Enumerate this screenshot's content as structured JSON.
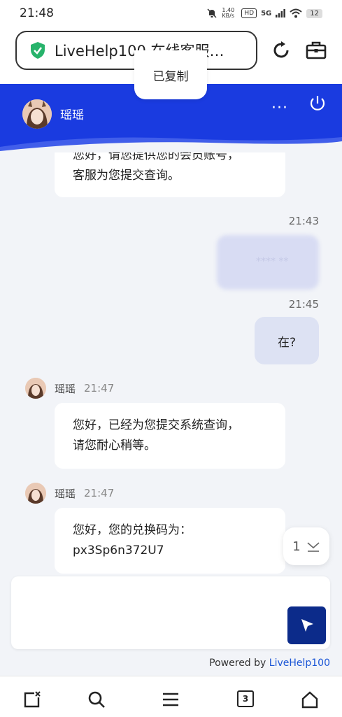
{
  "status_bar": {
    "time": "21:48",
    "net_speed": "1.40 KB/s",
    "hd": "HD",
    "signal": "5G",
    "battery": "12"
  },
  "browser": {
    "url_title": "LiveHelp100 在线客服…",
    "toast": "已复制"
  },
  "header": {
    "agent_name": "瑶瑶",
    "more": "···"
  },
  "messages": {
    "m1_line1": "您好，请您提供您的会员账号，",
    "m1_line2": "客服为您提交查询。",
    "time_1": "21:43",
    "blurred_text": "**** **",
    "time_2": "21:45",
    "user_msg_2": "在?",
    "agent_1_name": "瑶瑶",
    "agent_1_time": "21:47",
    "m3_line1": "您好，已经为您提交系统查询，",
    "m3_line2": "请您耐心稍等。",
    "agent_2_name": "瑶瑶",
    "agent_2_time": "21:47",
    "m4_line1": "您好，您的兑换码为：",
    "m4_line2": "px3Sp6n372U7"
  },
  "scroll_badge": {
    "count": "1"
  },
  "composer": {
    "placeholder": ""
  },
  "footer": {
    "powered_prefix": "Powered by ",
    "powered_brand": "LiveHelp100"
  },
  "nav": {
    "tabs_count": "3"
  }
}
